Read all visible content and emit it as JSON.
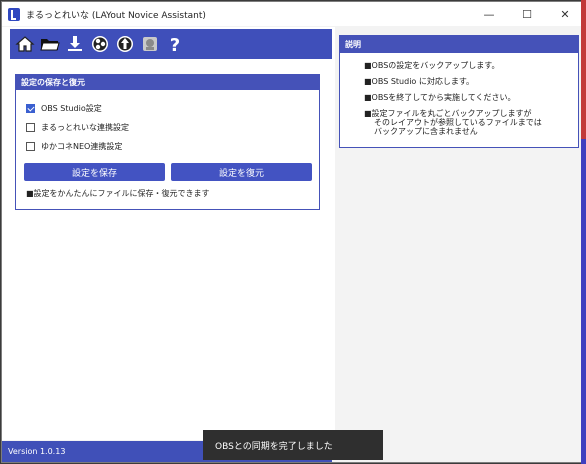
{
  "window": {
    "title": "まるっとれいな (LAYout Novice Assistant)",
    "controls": {
      "minimize": "—",
      "maximize": "☐",
      "close": "✕"
    }
  },
  "toolbar": {
    "icons": [
      "home-icon",
      "folder-icon",
      "download-icon",
      "obs-icon",
      "update-icon",
      "yukari-icon",
      "help-icon"
    ]
  },
  "backup_group": {
    "title": "設定の保存と復元",
    "options": [
      {
        "label": "OBS Studio設定",
        "checked": true
      },
      {
        "label": "まるっとれいな連携設定",
        "checked": false
      },
      {
        "label": "ゆかコネNEO連携設定",
        "checked": false
      }
    ],
    "save_button": "設定を保存",
    "restore_button": "設定を復元",
    "note": "■設定をかんたんにファイルに保存・復元できます"
  },
  "description": {
    "title": "説明",
    "lines": [
      "■OBSの設定をバックアップします。",
      "■OBS Studio に対応します。",
      "■OBSを終了してから実施してください。",
      "■設定ファイルを丸ごとバックアップしますが",
      "そのレイアウトが参照しているファイルまでは",
      "バックアップに含まれません"
    ]
  },
  "status": {
    "version": "Version 1.0.13",
    "toast": "OBSとの同期を完了しました"
  },
  "colors": {
    "accent": "#4552b8",
    "button": "#4353c2",
    "toast": "#2f2f2f"
  }
}
